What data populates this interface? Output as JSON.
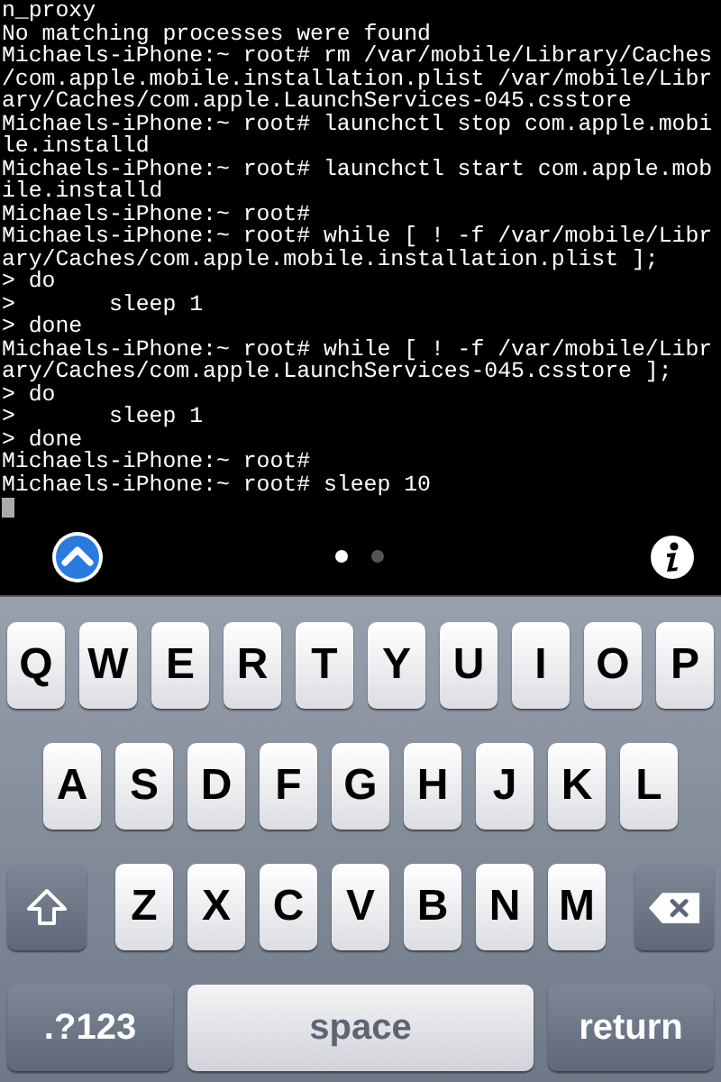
{
  "terminal": {
    "lines": [
      "n_proxy",
      "No matching processes were found",
      "Michaels-iPhone:~ root# rm /var/mobile/Library/Caches",
      "/com.apple.mobile.installation.plist /var/mobile/Libr",
      "ary/Caches/com.apple.LaunchServices-045.csstore",
      "Michaels-iPhone:~ root# launchctl stop com.apple.mobi",
      "le.installd",
      "Michaels-iPhone:~ root# launchctl start com.apple.mob",
      "ile.installd",
      "Michaels-iPhone:~ root#",
      "Michaels-iPhone:~ root# while [ ! -f /var/mobile/Libr",
      "ary/Caches/com.apple.mobile.installation.plist ];",
      "> do",
      ">       sleep 1",
      "> done",
      "Michaels-iPhone:~ root# while [ ! -f /var/mobile/Libr",
      "ary/Caches/com.apple.LaunchServices-045.csstore ];",
      "> do",
      ">       sleep 1",
      "> done",
      "Michaels-iPhone:~ root#",
      "Michaels-iPhone:~ root# sleep 10"
    ]
  },
  "pages": [
    {
      "selected": true
    },
    {
      "selected": false
    }
  ],
  "keyboard": {
    "letter_rows": [
      [
        "Q",
        "W",
        "E",
        "R",
        "T",
        "Y",
        "U",
        "I",
        "O",
        "P"
      ],
      [
        "A",
        "S",
        "D",
        "F",
        "G",
        "H",
        "J",
        "K",
        "L"
      ],
      [
        "Z",
        "X",
        "C",
        "V",
        "B",
        "N",
        "M"
      ]
    ],
    "bottom_keys": [
      {
        "kind": "mode",
        "label": ".?123"
      },
      {
        "kind": "space",
        "label": "space"
      },
      {
        "kind": "return",
        "label": "return"
      }
    ]
  }
}
